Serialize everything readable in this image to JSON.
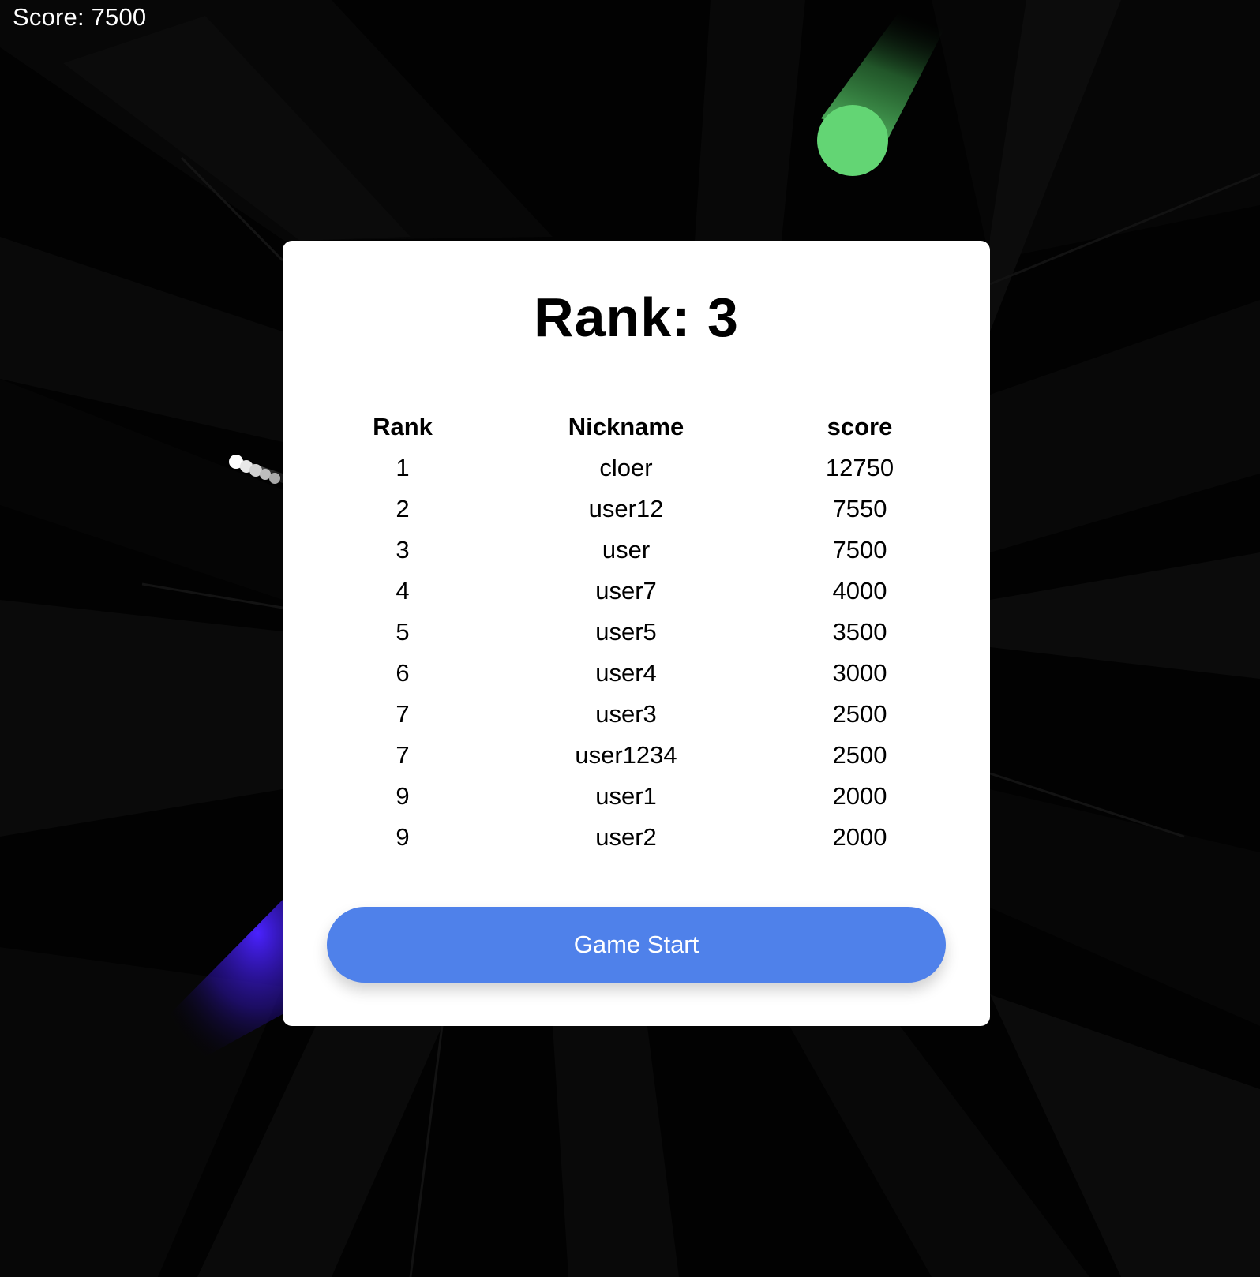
{
  "hud": {
    "score_text": "Score: 7500"
  },
  "modal": {
    "title": "Rank: 3",
    "table": {
      "headers": {
        "rank": "Rank",
        "nickname": "Nickname",
        "score": "score"
      },
      "rows": [
        {
          "rank": "1",
          "nickname": "cloer",
          "score": "12750"
        },
        {
          "rank": "2",
          "nickname": "user12",
          "score": "7550"
        },
        {
          "rank": "3",
          "nickname": "user",
          "score": "7500"
        },
        {
          "rank": "4",
          "nickname": "user7",
          "score": "4000"
        },
        {
          "rank": "5",
          "nickname": "user5",
          "score": "3500"
        },
        {
          "rank": "6",
          "nickname": "user4",
          "score": "3000"
        },
        {
          "rank": "7",
          "nickname": "user3",
          "score": "2500"
        },
        {
          "rank": "7",
          "nickname": "user1234",
          "score": "2500"
        },
        {
          "rank": "9",
          "nickname": "user1",
          "score": "2000"
        },
        {
          "rank": "9",
          "nickname": "user2",
          "score": "2000"
        }
      ]
    },
    "start_button_label": "Game Start"
  },
  "colors": {
    "background": "#020202",
    "modal": "#ffffff",
    "button": "#4f81ea",
    "green_orb": "#63d574",
    "white_orb": "#ffffff",
    "blue_glow": "#3b1fe0"
  }
}
